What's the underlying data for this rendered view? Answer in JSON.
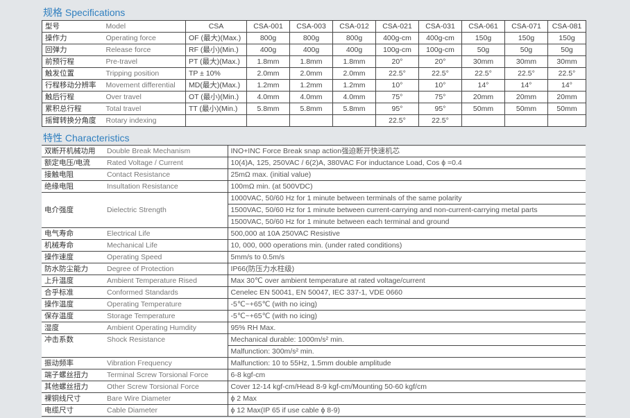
{
  "specifications": {
    "title": "规格 Specifications",
    "header": {
      "cn": "型号",
      "en": "Model",
      "condition": "CSA",
      "models": [
        "CSA-001",
        "CSA-003",
        "CSA-012",
        "CSA-021",
        "CSA-031",
        "CSA-061",
        "CSA-071",
        "CSA-081"
      ]
    },
    "rows": [
      {
        "cn": "操作力",
        "en": "Operating force",
        "condition": "OF (最大)(Max.)",
        "values": [
          "800g",
          "800g",
          "800g",
          "400g-cm",
          "400g-cm",
          "150g",
          "150g",
          "150g"
        ]
      },
      {
        "cn": "回弹力",
        "en": "Release force",
        "condition": "RF (最小)(Min.)",
        "values": [
          "400g",
          "400g",
          "400g",
          "100g-cm",
          "100g-cm",
          "50g",
          "50g",
          "50g"
        ]
      },
      {
        "cn": "前预行程",
        "en": "Pre-travel",
        "condition": "PT (最大)(Max.)",
        "values": [
          "1.8mm",
          "1.8mm",
          "1.8mm",
          "20°",
          "20°",
          "30mm",
          "30mm",
          "30mm"
        ]
      },
      {
        "cn": "触发位置",
        "en": "Tripping position",
        "condition": "TP ± 10%",
        "values": [
          "2.0mm",
          "2.0mm",
          "2.0mm",
          "22.5°",
          "22.5°",
          "22.5°",
          "22.5°",
          "22.5°"
        ]
      },
      {
        "cn": "行程移动分辨率",
        "en": "Movement differential",
        "condition": "MD(最大)(Max.)",
        "values": [
          "1.2mm",
          "1.2mm",
          "1.2mm",
          "10°",
          "10°",
          "14°",
          "14°",
          "14°"
        ]
      },
      {
        "cn": "触后行程",
        "en": "Over travel",
        "condition": "OT (最小)(Min.)",
        "values": [
          "4.0mm",
          "4.0mm",
          "4.0mm",
          "75°",
          "75°",
          "20mm",
          "20mm",
          "20mm"
        ]
      },
      {
        "cn": "累积总行程",
        "en": "Total travel",
        "condition": "TT (最小)(Min.)",
        "values": [
          "5.8mm",
          "5.8mm",
          "5.8mm",
          "95°",
          "95°",
          "50mm",
          "50mm",
          "50mm"
        ]
      },
      {
        "cn": "摇臂转换分角度",
        "en": "Rotary indexing",
        "condition": "",
        "values": [
          "",
          "",
          "",
          "22.5°",
          "22.5°",
          "",
          "",
          ""
        ]
      }
    ]
  },
  "characteristics": {
    "title": "特性 Characteristics",
    "rows": [
      {
        "cn": "双断开机械功用",
        "en": "Double Break Mechanism",
        "values": [
          "INO+INC Force Break snap action强迫断开快速机芯"
        ]
      },
      {
        "cn": "额定电压/电流",
        "en": "Rated Voltage / Current",
        "values": [
          "10(4)A, 125, 250VAC / 6(2)A, 380VAC     For inductance Load, Cos ϕ =0.4"
        ]
      },
      {
        "cn": "接触电阻",
        "en": "Contact Resistance",
        "values": [
          "25mΩ  max. (initial value)"
        ]
      },
      {
        "cn": "绝缘电阻",
        "en": "Insultation Resistance",
        "values": [
          "100mΩ min. (at 500VDC)"
        ]
      },
      {
        "cn": "电介强度",
        "en": "Dielectric Strength",
        "values": [
          "1000VAC, 50/60 Hz for 1 minute between terminals of the same polarity",
          "1500VAC, 50/60 Hz for 1 minute between current-carrying and non-current-carrying metal parts",
          "1500VAC, 50/60 Hz for 1 minute between each terminal and ground"
        ]
      },
      {
        "cn": "电气寿命",
        "en": "Electrical Life",
        "values": [
          "500,000 at 10A 250VAC Resistive"
        ]
      },
      {
        "cn": "机械寿命",
        "en": "Mechanical Life",
        "values": [
          "10, 000, 000 operations min. (under rated conditions)"
        ]
      },
      {
        "cn": "操作速度",
        "en": "Operating Speed",
        "values": [
          "5mm/s to 0.5m/s"
        ]
      },
      {
        "cn": "防水防尘能力",
        "en": "Degree of Protection",
        "values": [
          "IP66(防压力水柱级)"
        ]
      },
      {
        "cn": "上升温度",
        "en": "Ambient Temperature Rised",
        "values": [
          "Max 30℃ over ambient temperature at rated voltage/current"
        ]
      },
      {
        "cn": "合乎标准",
        "en": "Conformed Standards",
        "values": [
          "Cenelec EN 50041, EN 50047, IEC 337-1, VDE 0660"
        ]
      },
      {
        "cn": "操作温度",
        "en": "Operating Temperature",
        "values": [
          "-5℃~+65℃ (with no icing)"
        ]
      },
      {
        "cn": "保存温度",
        "en": "Storage Temperature",
        "values": [
          "-5℃~+65℃ (with no icing)"
        ]
      },
      {
        "cn": "湿度",
        "en": "Ambient Operating Humdity",
        "values": [
          "95% RH Max."
        ]
      },
      {
        "cn": "冲击系数",
        "en": "Shock Resistance",
        "values": [
          "Mechanical durable: 1000m/s² min.",
          "Malfunction: 300m/s² min."
        ]
      },
      {
        "cn": "振动频率",
        "en": "Vibration Frequency",
        "values": [
          "Malfunction: 10 to 55Hz, 1.5mm double amplitude"
        ]
      },
      {
        "cn": "端子螺丝扭力",
        "en": "Terminal Screw Torsional Force",
        "values": [
          "6-8 kgf-cm"
        ]
      },
      {
        "cn": "其他螺丝扭力",
        "en": "Other Screw Torsional Force",
        "values": [
          "Cover 12-14 kgf-cm/Head 8-9 kgf-cm/Mounting 50-60 kgf/cm"
        ]
      },
      {
        "cn": "裸铜线尺寸",
        "en": "Bare Wire Diameter",
        "values": [
          "ϕ 2 Max"
        ]
      },
      {
        "cn": "电缆尺寸",
        "en": "Cable Diameter",
        "values": [
          "ϕ 12 Max(IP 65 if use cable  ϕ 8-9)"
        ]
      }
    ]
  }
}
